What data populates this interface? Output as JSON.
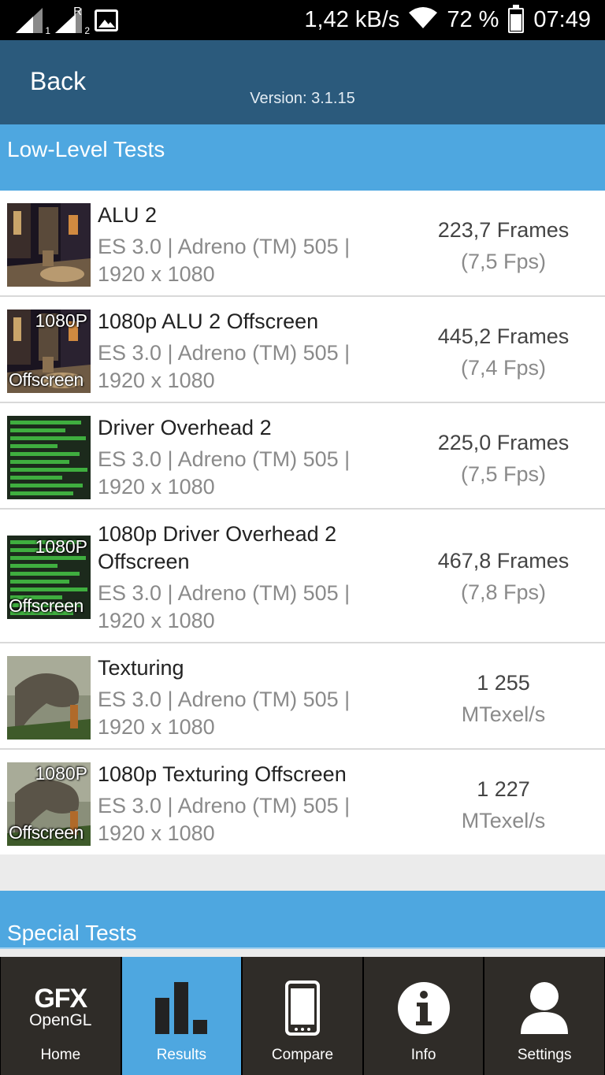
{
  "status_bar": {
    "speed": "1,42 kB/s",
    "battery": "72 %",
    "time": "07:49",
    "sim1_sub": "1",
    "sim2_sup": "R",
    "sim2_sub": "2",
    "battery_level": 0.72,
    "icons": [
      "signal-icon",
      "signal-roaming-icon",
      "image-notification-icon",
      "wifi-icon",
      "battery-icon"
    ]
  },
  "header": {
    "back_label": "Back",
    "version": "Version: 3.1.15"
  },
  "sections": {
    "low_level": "Low-Level Tests",
    "special": "Special Tests"
  },
  "tests": [
    {
      "name": "ALU 2",
      "desc": "ES 3.0 | Adreno (TM) 505 | 1920 x 1080",
      "result_main": "223,7 Frames",
      "result_sub": "(7,5 Fps)",
      "thumb": "city-scene",
      "offscreen": false
    },
    {
      "name": "1080p ALU 2 Offscreen",
      "desc": "ES 3.0 | Adreno (TM) 505 | 1920 x 1080",
      "result_main": "445,2 Frames",
      "result_sub": "(7,4 Fps)",
      "thumb": "city-scene",
      "offscreen": true,
      "badge_top": "1080P",
      "badge_bottom": "Offscreen"
    },
    {
      "name": "Driver Overhead 2",
      "desc": "ES 3.0 | Adreno (TM) 505 | 1920 x 1080",
      "result_main": "225,0 Frames",
      "result_sub": "(7,5 Fps)",
      "thumb": "green-bars",
      "offscreen": false
    },
    {
      "name": "1080p Driver Overhead 2 Offscreen",
      "desc": "ES 3.0 | Adreno (TM) 505 | 1920 x 1080",
      "result_main": "467,8 Frames",
      "result_sub": "(7,8 Fps)",
      "thumb": "green-bars",
      "offscreen": true,
      "badge_top": "1080P",
      "badge_bottom": "Offscreen"
    },
    {
      "name": "Texturing",
      "desc": "ES 3.0 | Adreno (TM) 505 | 1920 x 1080",
      "result_main": "1 255",
      "result_sub": "MTexel/s",
      "thumb": "dinosaur",
      "offscreen": false
    },
    {
      "name": "1080p Texturing Offscreen",
      "desc": "ES 3.0 | Adreno (TM) 505 | 1920 x 1080",
      "result_main": "1 227",
      "result_sub": "MTexel/s",
      "thumb": "dinosaur",
      "offscreen": true,
      "badge_top": "1080P",
      "badge_bottom": "Offscreen"
    }
  ],
  "nav": {
    "logo_line1": "GFX",
    "logo_line2": "OpenGL",
    "items": [
      {
        "label": "Home",
        "icon": "gfx-logo-icon"
      },
      {
        "label": "Results",
        "icon": "bar-chart-icon"
      },
      {
        "label": "Compare",
        "icon": "phone-icon"
      },
      {
        "label": "Info",
        "icon": "info-icon"
      },
      {
        "label": "Settings",
        "icon": "user-icon"
      }
    ],
    "active": "Results"
  },
  "colors": {
    "status_bar": "#000000",
    "app_bar": "#2b5a7c",
    "section_header": "#4ea7e0",
    "nav_bg": "#2f2c28",
    "nav_active": "#4ea7e0"
  }
}
